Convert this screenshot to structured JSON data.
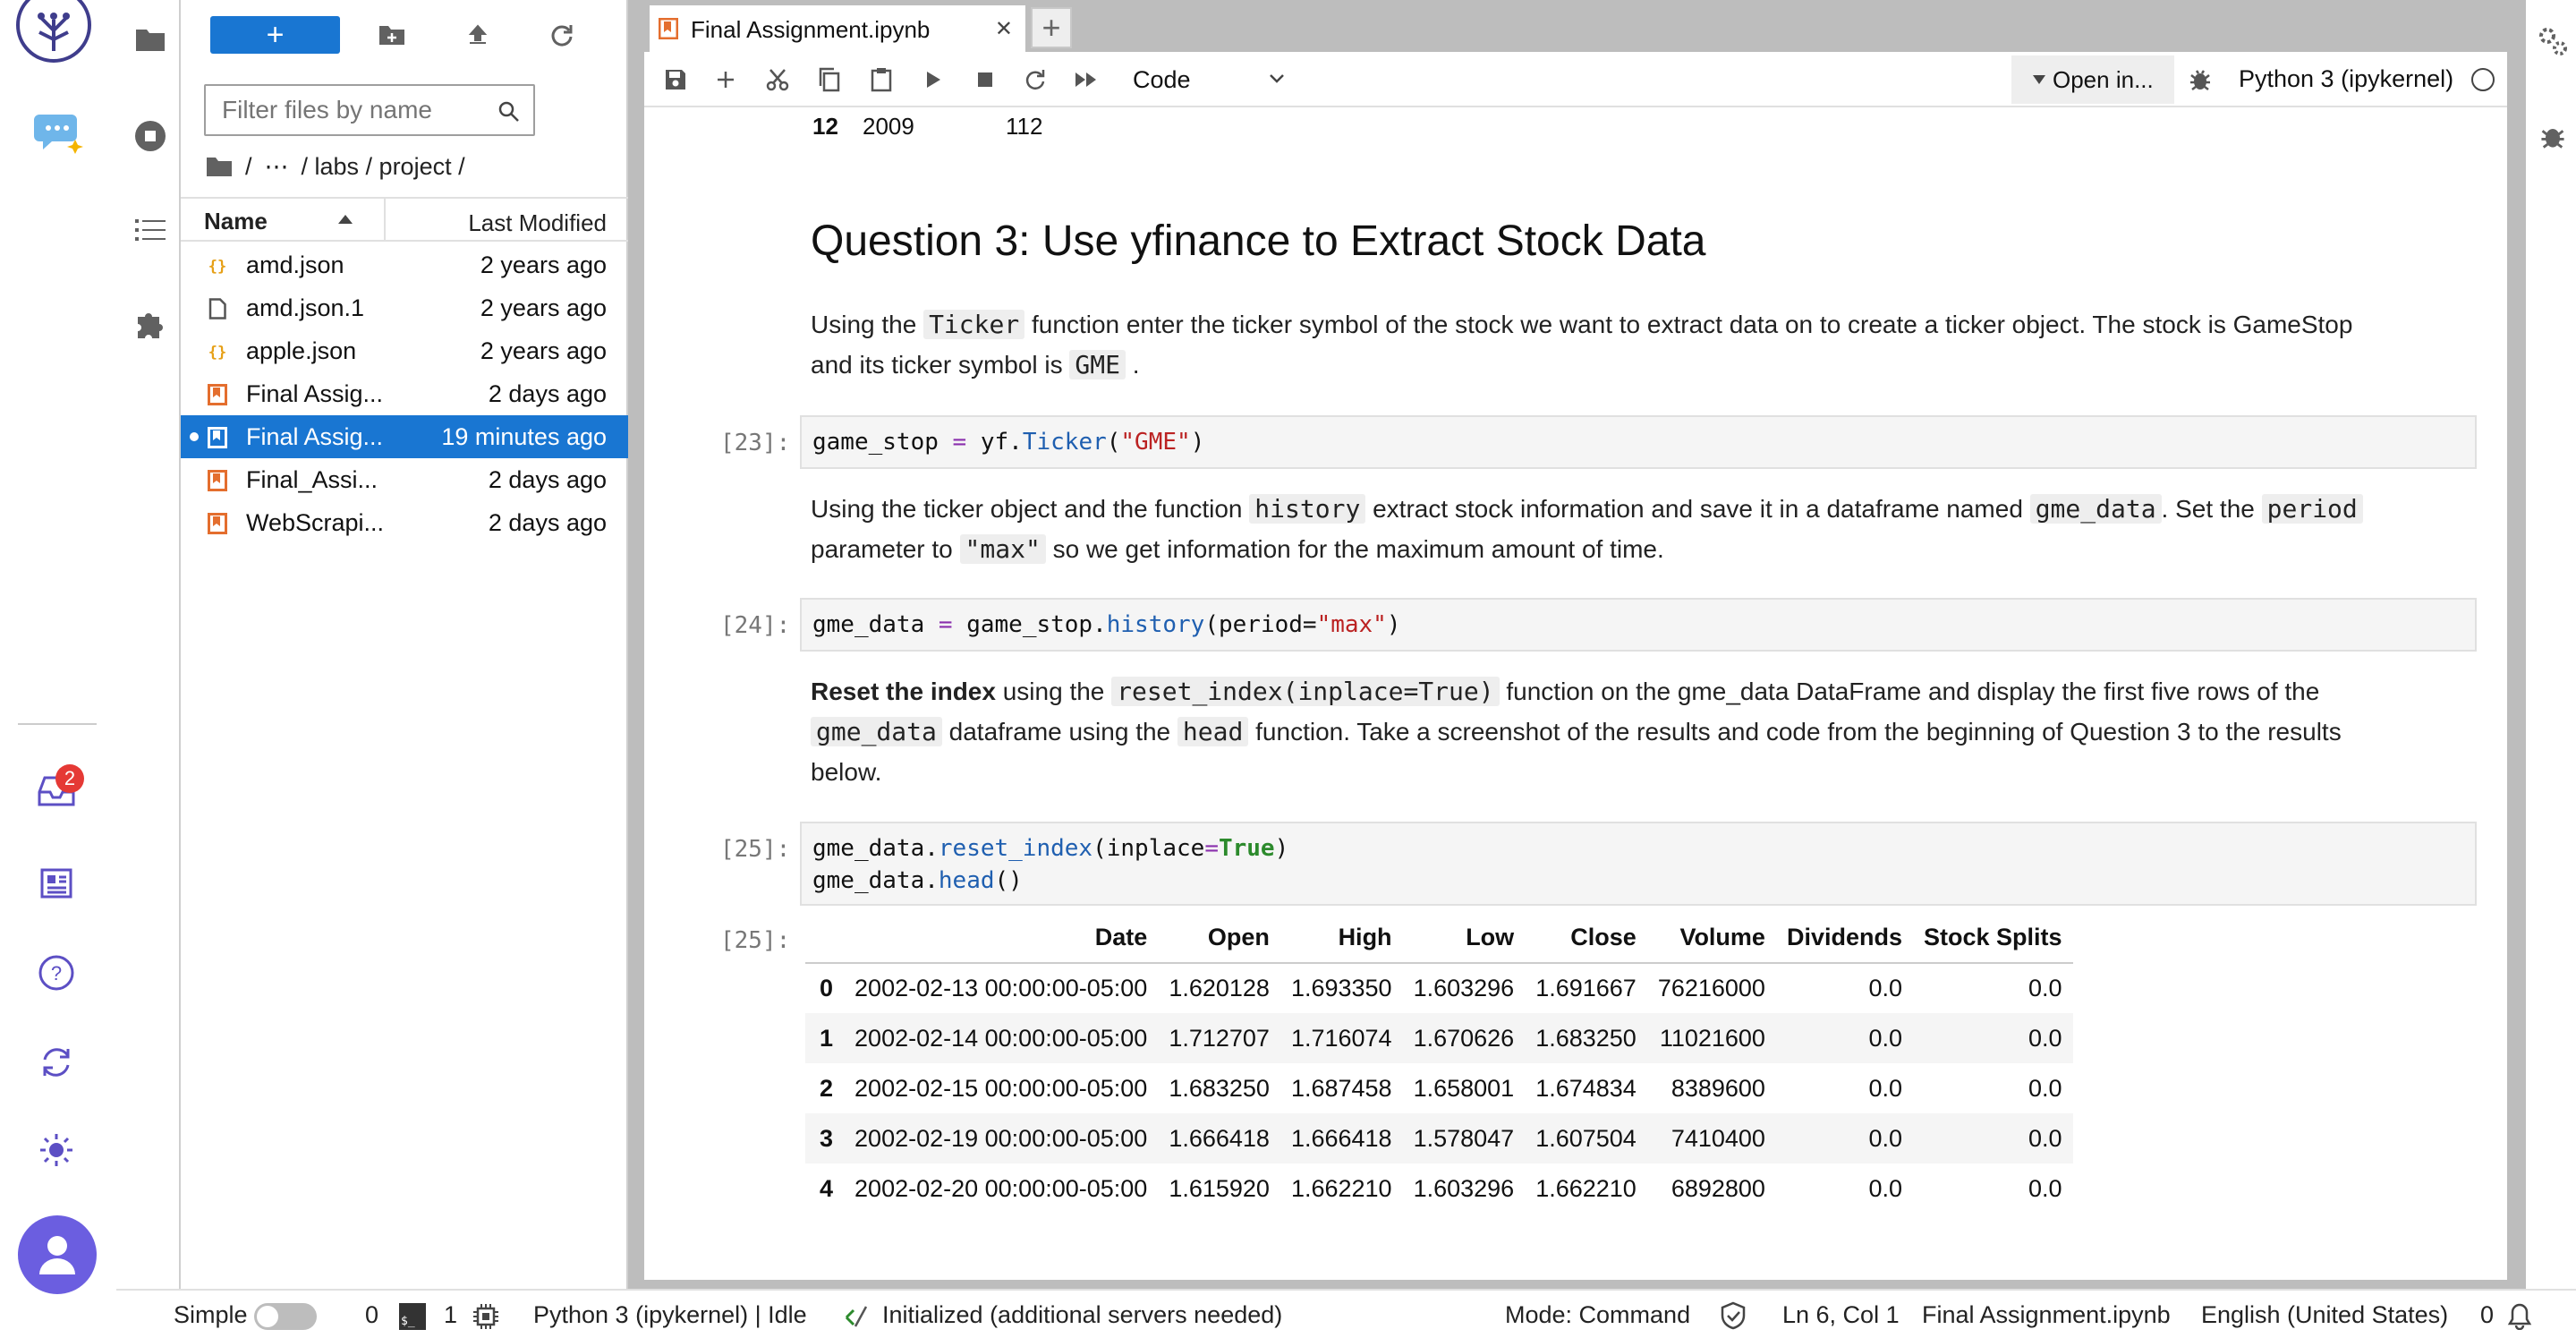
{
  "app": {
    "logo": "jupyter-logo-icon",
    "assistant": "chat-assistant-icon"
  },
  "activity": {
    "icons": [
      "folder-icon",
      "running-icon",
      "toc-icon",
      "extension-icon"
    ]
  },
  "sidebar_bottom": {
    "badge_count": "2"
  },
  "filebrowser": {
    "new_label": "+",
    "filter_placeholder": "Filter files by name",
    "breadcrumb": {
      "root": "/",
      "ellipsis": "⋯",
      "path": "/ labs / project /"
    },
    "headers": {
      "name": "Name",
      "modified": "Last Modified"
    },
    "files": [
      {
        "name": "amd.json",
        "modified": "2 years ago",
        "type": "json"
      },
      {
        "name": "amd.json.1",
        "modified": "2 years ago",
        "type": "file"
      },
      {
        "name": "apple.json",
        "modified": "2 years ago",
        "type": "json"
      },
      {
        "name": "Final Assig...",
        "modified": "2 days ago",
        "type": "notebook"
      },
      {
        "name": "Final Assig...",
        "modified": "19 minutes ago",
        "type": "notebook",
        "selected": true
      },
      {
        "name": "Final_Assi...",
        "modified": "2 days ago",
        "type": "notebook"
      },
      {
        "name": "WebScrapi...",
        "modified": "2 days ago",
        "type": "notebook"
      }
    ]
  },
  "tab": {
    "title": "Final Assignment.ipynb",
    "close": "✕",
    "add": "+"
  },
  "toolbar": {
    "cell_type": "Code",
    "open_in": "Open in...",
    "kernel": "Python 3 (ipykernel)"
  },
  "notebook": {
    "prev_row": {
      "idx": "12",
      "year": "2009",
      "value": "112"
    },
    "heading": "Question 3: Use yfinance to Extract Stock Data",
    "p1": {
      "a": "Using the",
      "code1": "Ticker",
      "b": "function enter the ticker symbol of the stock we want to extract data on to create a ticker object. The stock is GameStop",
      "c": "and its ticker symbol is",
      "code2": "GME",
      "d": "."
    },
    "cell23": {
      "prompt": "[23]:",
      "v": "game_stop",
      "eq": " = ",
      "obj": "yf.",
      "fn": "Ticker",
      "open": "(",
      "arg": "\"GME\"",
      "close": ")"
    },
    "p2": {
      "a": "Using the ticker object and the function",
      "code1": "history",
      "b": "extract stock information and save it in a dataframe named",
      "code2": "gme_data",
      "c": ". Set the",
      "code3": "period",
      "d": "parameter to",
      "code4": "\"max\"",
      "e": "so we get information for the maximum amount of time."
    },
    "cell24": {
      "prompt": "[24]:",
      "v": "gme_data",
      "eq": " = ",
      "obj": "game_stop.",
      "fn": "history",
      "open": "(period=",
      "arg": "\"max\"",
      "close": ")"
    },
    "p3": {
      "bold": "Reset the index",
      "a": "using the",
      "code1": "reset_index(inplace=True)",
      "b": "function on the gme_data DataFrame and display the first five rows of the",
      "code2": "gme_data",
      "c": "dataframe using the",
      "code3": "head",
      "d": "function. Take a screenshot of the results and code from the beginning of Question 3 to the results",
      "e": "below."
    },
    "cell25": {
      "prompt": "[25]:",
      "l1a": "gme_data.",
      "l1fn": "reset_index",
      "l1b": "(inplace",
      "l1eq": "=",
      "l1val": "True",
      "l1c": ")",
      "l2a": "gme_data.",
      "l2fn": "head",
      "l2b": "()"
    },
    "out25": {
      "prompt": "[25]:"
    }
  },
  "table": {
    "columns": [
      "",
      "Date",
      "Open",
      "High",
      "Low",
      "Close",
      "Volume",
      "Dividends",
      "Stock Splits"
    ],
    "rows": [
      [
        "0",
        "2002-02-13 00:00:00-05:00",
        "1.620128",
        "1.693350",
        "1.603296",
        "1.691667",
        "76216000",
        "0.0",
        "0.0"
      ],
      [
        "1",
        "2002-02-14 00:00:00-05:00",
        "1.712707",
        "1.716074",
        "1.670626",
        "1.683250",
        "11021600",
        "0.0",
        "0.0"
      ],
      [
        "2",
        "2002-02-15 00:00:00-05:00",
        "1.683250",
        "1.687458",
        "1.658001",
        "1.674834",
        "8389600",
        "0.0",
        "0.0"
      ],
      [
        "3",
        "2002-02-19 00:00:00-05:00",
        "1.666418",
        "1.666418",
        "1.578047",
        "1.607504",
        "7410400",
        "0.0",
        "0.0"
      ],
      [
        "4",
        "2002-02-20 00:00:00-05:00",
        "1.615920",
        "1.662210",
        "1.603296",
        "1.662210",
        "6892800",
        "0.0",
        "0.0"
      ]
    ]
  },
  "status": {
    "simple": "Simple",
    "terminals": "0",
    "kernels": "1",
    "kernel_status": "Python 3 (ipykernel) | Idle",
    "lsp": "Initialized (additional servers needed)",
    "mode": "Mode: Command",
    "position": "Ln 6, Col 1",
    "file": "Final Assignment.ipynb",
    "language": "English (United States)",
    "notifications": "0"
  },
  "colors": {
    "accent": "#1976d2",
    "badge": "#e53935",
    "sidebar_icon": "#5c4fc4"
  }
}
